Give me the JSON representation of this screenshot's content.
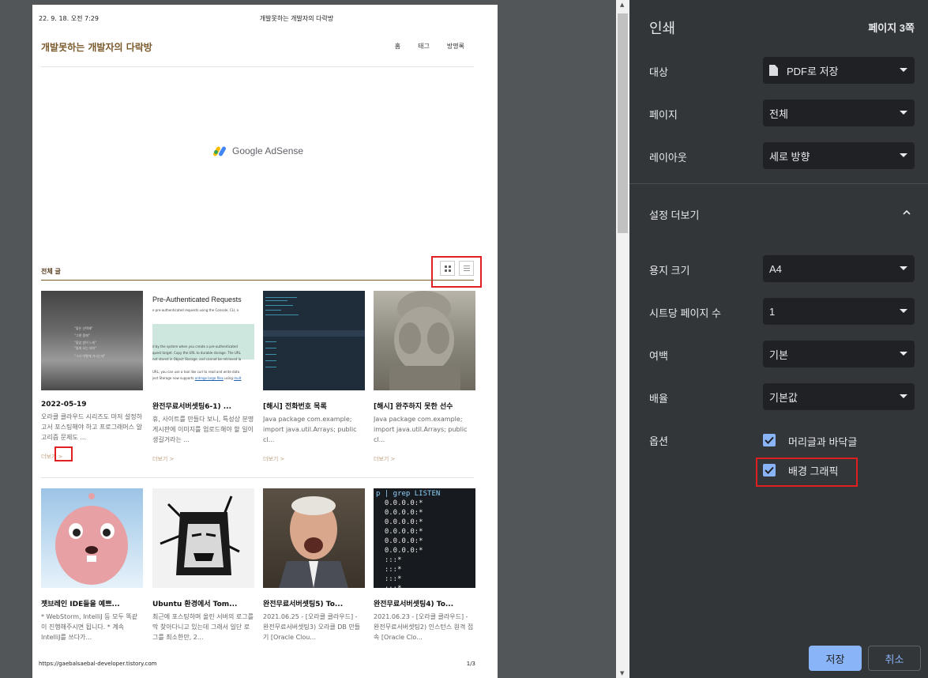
{
  "preview": {
    "header_date": "22. 9. 18. 오전 7:29",
    "header_title": "개발못하는 개발자의 다락방",
    "blog_title": "개발못하는 개발자의 다락방",
    "nav": [
      "홈",
      "태그",
      "방명록"
    ],
    "ad_text": "Google AdSense",
    "section_label": "전체 글",
    "more_label": "더보기 >",
    "posts": [
      {
        "title": "2022-05-19",
        "excerpt": "오라클 클라우드 시리즈도 마저 설정하고서 포스팅해야 하고 프로그래머스 알고리즘 문제도 ..."
      },
      {
        "title": "완전무료서버셋팅6-1) ...",
        "excerpt": "휴, 사이트를 만들다 보니, 특성상 분명 게시판에 이미지를 업로드해야 할 일이 생길거라는 ..."
      },
      {
        "title": "[해시] 전화번호 목록",
        "excerpt": "Java package com.example; import java.util.Arrays; public cl..."
      },
      {
        "title": "[해시] 완주하지 못한 선수",
        "excerpt": "Java package com.example; import java.util.Arrays; public cl..."
      },
      {
        "title": "젯브레인 IDE들을 예쁘...",
        "excerpt": "* WebStorm, IntelliJ 등 모두 똑같이 진행해주시면 됩니다. * 계속 IntelliJ를 쓰다가..."
      },
      {
        "title": "Ubuntu 환경에서 Tom...",
        "excerpt": "최근에 포스팅하며 올린 서버의 로그를 막 찾아다니고 있는데 그래서 일단 로그를 최소한만, 2..."
      },
      {
        "title": "완전무료서버셋팅5) To...",
        "excerpt": "2021.06.25 - [오라클 클라우드] - 완전무료서버셋팅3) 오라클 DB 만들기 [Oracle Clou..."
      },
      {
        "title": "완전무료서버셋팅4) To...",
        "excerpt": "2021.06.23 - [오라클 클라우드] - 완전무료서버셋팅2) 인스턴스 원격 접속 [Oracle Clo..."
      }
    ],
    "thumb2_header": "Pre-Authenticated Requests",
    "thumb2_lines": [
      "e pre-authenticated requests using the Console, CLI, o",
      "d by the system when you create a pre-authenticated",
      "quest target. Copy the URL to durable storage. The URL",
      "not stored in Object Storage, and cannot be retrieved la",
      "URL, you can use a tool like curl to read and write data",
      "ject Storage now supports",
      "ontinge large files",
      "using",
      "mult"
    ],
    "thumb1_lines": [
      "\"좋은 선택해\"",
      "\"그렇 몸에\"",
      "\"좋았 방이 느끼\"",
      "\"좋게 오는 바이\"",
      "\"그녀 어떻게 가시는데\""
    ],
    "thumb8_lines": [
      "p | grep LISTEN",
      "  0.0.0.0:*",
      "  0.0.0.0:*",
      "  0.0.0.0:*",
      "  0.0.0.0:*",
      "  0.0.0.0:*",
      "  0.0.0.0:*",
      "  :::*",
      "  :::*",
      "  :::*",
      "  :::*"
    ],
    "footer_url": "https://gaebalsaebal-developer.tistory.com",
    "footer_page": "1/3"
  },
  "settings": {
    "title": "인쇄",
    "page_count": "페이지 3쪽",
    "destination_label": "대상",
    "destination_value": "PDF로 저장",
    "pages_label": "페이지",
    "pages_value": "전체",
    "layout_label": "레이아웃",
    "layout_value": "세로 방향",
    "more_settings": "설정 더보기",
    "paper_label": "용지 크기",
    "paper_value": "A4",
    "pps_label": "시트당 페이지 수",
    "pps_value": "1",
    "margins_label": "여백",
    "margins_value": "기본",
    "scale_label": "배율",
    "scale_value": "기본값",
    "options_label": "옵션",
    "opt_headers": "머리글과 바닥글",
    "opt_background": "배경 그래픽",
    "save_button": "저장",
    "cancel_button": "취소"
  },
  "colors": {
    "accent": "#8ab4f8",
    "panel_bg": "#323639",
    "highlight_red": "#e02020",
    "blog_brown": "#7a5a2c"
  }
}
